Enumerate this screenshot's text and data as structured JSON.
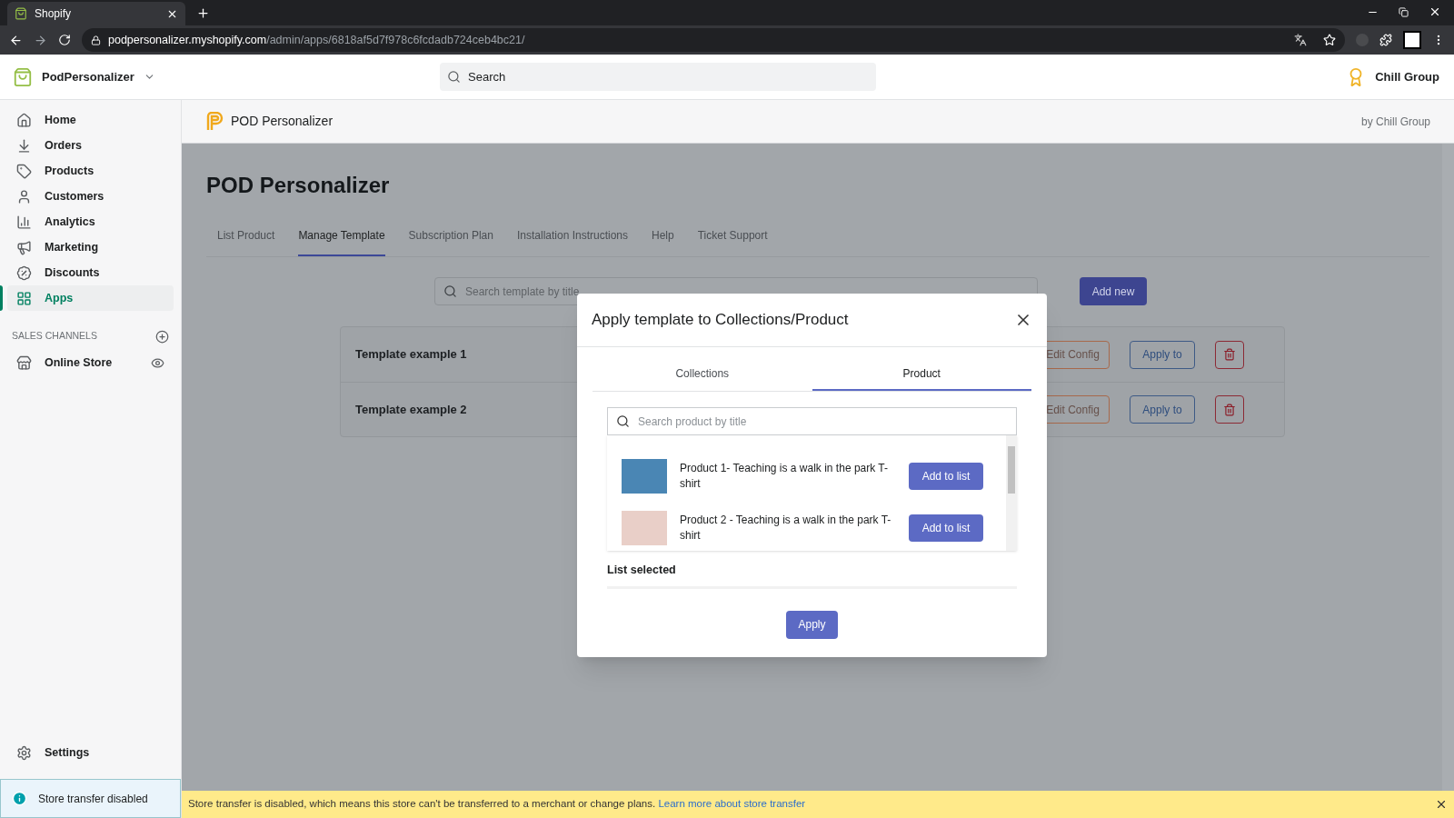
{
  "browser": {
    "tab_title": "Shopify",
    "url_host": "podpersonalizer.myshopify.com",
    "url_path": "/admin/apps/6818af5d7f978c6fcdadb724ceb4bc21/"
  },
  "topbar": {
    "store_name": "PodPersonalizer",
    "search_placeholder": "Search",
    "account_name": "Chill Group"
  },
  "sidebar": {
    "items": [
      {
        "label": "Home",
        "selected": false
      },
      {
        "label": "Orders",
        "selected": false
      },
      {
        "label": "Products",
        "selected": false
      },
      {
        "label": "Customers",
        "selected": false
      },
      {
        "label": "Analytics",
        "selected": false
      },
      {
        "label": "Marketing",
        "selected": false
      },
      {
        "label": "Discounts",
        "selected": false
      },
      {
        "label": "Apps",
        "selected": true
      }
    ],
    "sales_channels_label": "SALES CHANNELS",
    "channels": [
      {
        "label": "Online Store"
      }
    ],
    "settings": "Settings",
    "notice": "Store transfer disabled"
  },
  "app_header": {
    "title": "POD Personalizer",
    "by": "by Chill Group"
  },
  "page": {
    "title": "POD Personalizer",
    "tabs": [
      {
        "label": "List Product",
        "selected": false
      },
      {
        "label": "Manage Template",
        "selected": true
      },
      {
        "label": "Subscription Plan",
        "selected": false
      },
      {
        "label": "Installation Instructions",
        "selected": false
      },
      {
        "label": "Help",
        "selected": false
      },
      {
        "label": "Ticket Support",
        "selected": false
      }
    ],
    "search_placeholder": "Search template by title",
    "add_new": "Add new",
    "templates": [
      {
        "name": "Template example 1",
        "edit": "Edit Config",
        "apply": "Apply to"
      },
      {
        "name": "Template example 2",
        "edit": "Edit Config",
        "apply": "Apply to"
      }
    ]
  },
  "modal": {
    "title": "Apply template to Collections/Product",
    "tabs": [
      {
        "label": "Collections",
        "selected": false
      },
      {
        "label": "Product",
        "selected": true
      }
    ],
    "search_placeholder": "Search product by title",
    "products": [
      {
        "name": "Product 1- Teaching is a walk in the park T-shirt",
        "button": "Add to list"
      },
      {
        "name": "Product 2 - Teaching is a walk in the park T-shirt",
        "button": "Add to list"
      }
    ],
    "list_selected": "List selected",
    "apply": "Apply"
  },
  "banner": {
    "text": "Store transfer is disabled, which means this store can't be transferred to a merchant or change plans.",
    "link": "Learn more about store transfer"
  }
}
